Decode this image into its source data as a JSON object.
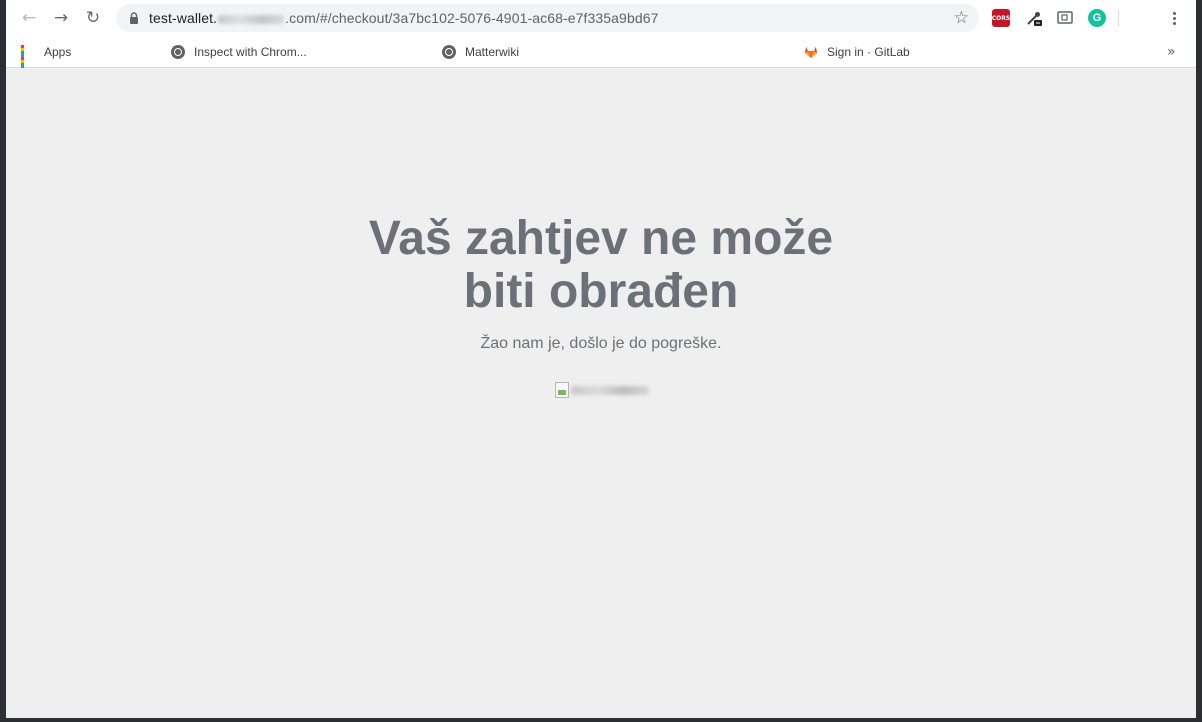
{
  "browser": {
    "nav": {
      "back_icon": "←",
      "forward_icon": "→",
      "reload_icon": "↻"
    },
    "address_bar": {
      "url_prefix": "test-wallet.",
      "url_suffix": ".com/#/checkout/3a7bc102-5076-4901-ac68-e7f335a9bd67",
      "star_icon": "☆"
    },
    "extensions": {
      "cors_label": "CORS",
      "grammarly_label": "G"
    },
    "bookmarks": [
      {
        "label": "Apps",
        "icon": "apps-grid-icon"
      },
      {
        "label": "Inspect with Chrom...",
        "icon": "globe-icon"
      },
      {
        "label": "Matterwiki",
        "icon": "globe-icon"
      },
      {
        "label": "Sign in · GitLab",
        "icon": "gitlab-icon"
      }
    ],
    "more_bookmarks_icon": "»"
  },
  "page": {
    "headline_line1": "Vaš zahtjev ne može",
    "headline_line2": "biti obrađen",
    "message": "Žao nam je, došlo je do pogreške."
  },
  "colors": {
    "headline": "#6c7179",
    "background": "#efefef"
  }
}
